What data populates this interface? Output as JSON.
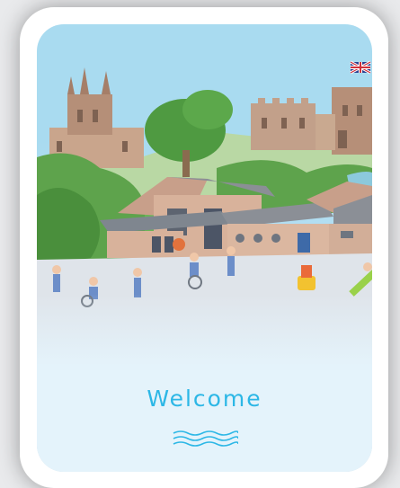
{
  "welcome": {
    "title": "Welcome"
  },
  "icons": {
    "flag": "union-jack-flag-icon",
    "wave": "wave-divider-icon"
  },
  "colors": {
    "accent": "#2cb7e6",
    "sky": "#a9dbf0",
    "lower_panel": "#e4f3fb"
  }
}
